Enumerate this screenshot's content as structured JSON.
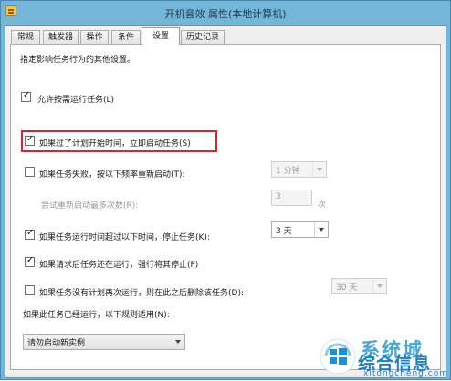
{
  "window": {
    "title": "开机音效 属性(本地计算机)"
  },
  "tabs": [
    {
      "label": "常规"
    },
    {
      "label": "触发器"
    },
    {
      "label": "操作"
    },
    {
      "label": "条件"
    },
    {
      "label": "设置"
    },
    {
      "label": "历史记录"
    }
  ],
  "active_tab": "设置",
  "settings": {
    "description": "指定影响任务行为的其他设置。",
    "allow_on_demand": {
      "label": "允许按需运行任务(L)",
      "checked": true
    },
    "run_after_missed": {
      "label": "如果过了计划开始时间，立即启动任务(S)",
      "checked": true,
      "highlighted": true
    },
    "restart_on_fail": {
      "label": "如果任务失败，按以下频率重新启动(T):",
      "checked": false,
      "interval_value": "1 分钟"
    },
    "restart_attempts": {
      "label": "尝试重新启动最多次数(R):",
      "value": "3",
      "unit": "次"
    },
    "stop_if_longer": {
      "label": "如果任务运行时间超过以下时间，停止任务(K):",
      "checked": true,
      "value": "3 天"
    },
    "force_stop": {
      "label": "如果请求后任务还在运行，强行将其停止(F)",
      "checked": true
    },
    "delete_if_not_scheduled": {
      "label": "如果任务没有计划再次运行，则在此之后删除该任务(D):",
      "checked": false,
      "value": "30 天"
    },
    "rule_label": "如果此任务已经运行，以下规则适用(N):",
    "rule_value": "请勿启动新实例"
  },
  "watermark": {
    "brand_top": "系统城",
    "brand_main": "综合信息",
    "url": "xitongcheng.com"
  },
  "colors": {
    "highlight": "#e0222a",
    "title_bar": "#73b6d8"
  }
}
